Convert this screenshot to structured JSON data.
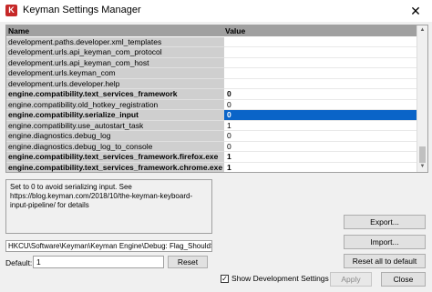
{
  "window": {
    "title": "Keyman Settings Manager",
    "icon": "keyman-icon",
    "close_glyph": "✕"
  },
  "grid": {
    "columns": {
      "name": "Name",
      "value": "Value"
    },
    "rows": [
      {
        "name": "development.paths.developer.xml_templates",
        "value": "",
        "bold": false,
        "selected": false
      },
      {
        "name": "development.urls.api_keyman_com_protocol",
        "value": "",
        "bold": false,
        "selected": false
      },
      {
        "name": "development.urls.api_keyman_com_host",
        "value": "",
        "bold": false,
        "selected": false
      },
      {
        "name": "development.urls.keyman_com",
        "value": "",
        "bold": false,
        "selected": false
      },
      {
        "name": "development.urls.developer.help",
        "value": "",
        "bold": false,
        "selected": false
      },
      {
        "name": "engine.compatibility.text_services_framework",
        "value": "0",
        "bold": true,
        "selected": false
      },
      {
        "name": "engine.compatibility.old_hotkey_registration",
        "value": "0",
        "bold": false,
        "selected": false
      },
      {
        "name": "engine.compatibility.serialize_input",
        "value": "0",
        "bold": true,
        "selected": true
      },
      {
        "name": "engine.compatibility.use_autostart_task",
        "value": "1",
        "bold": false,
        "selected": false
      },
      {
        "name": "engine.diagnostics.debug_log",
        "value": "0",
        "bold": false,
        "selected": false
      },
      {
        "name": "engine.diagnostics.debug_log_to_console",
        "value": "0",
        "bold": false,
        "selected": false
      },
      {
        "name": "engine.compatibility.text_services_framework.firefox.exe",
        "value": "1",
        "bold": true,
        "selected": false
      },
      {
        "name": "engine.compatibility.text_services_framework.chrome.exe",
        "value": "1",
        "bold": true,
        "selected": false
      }
    ]
  },
  "description": "Set to 0 to avoid serializing input. See https://blog.keyman.com/2018/10/the-keyman-keyboard-input-pipeline/ for details",
  "registry_path": "HKCU\\Software\\Keyman\\Keyman Engine\\Debug: Flag_ShouldSerializeInput",
  "default": {
    "label": "Default:",
    "value": "1",
    "reset_label": "Reset"
  },
  "buttons": {
    "export": "Export...",
    "import": "Import...",
    "reset_all": "Reset all to default",
    "apply": "Apply",
    "close": "Close"
  },
  "show_development": {
    "label": "Show Development Settings",
    "checked": true,
    "check_glyph": "✓"
  },
  "colors": {
    "selection": "#0a64c8",
    "name_column_bg": "#cfcfcf",
    "header_bg": "#a0a0a0"
  }
}
